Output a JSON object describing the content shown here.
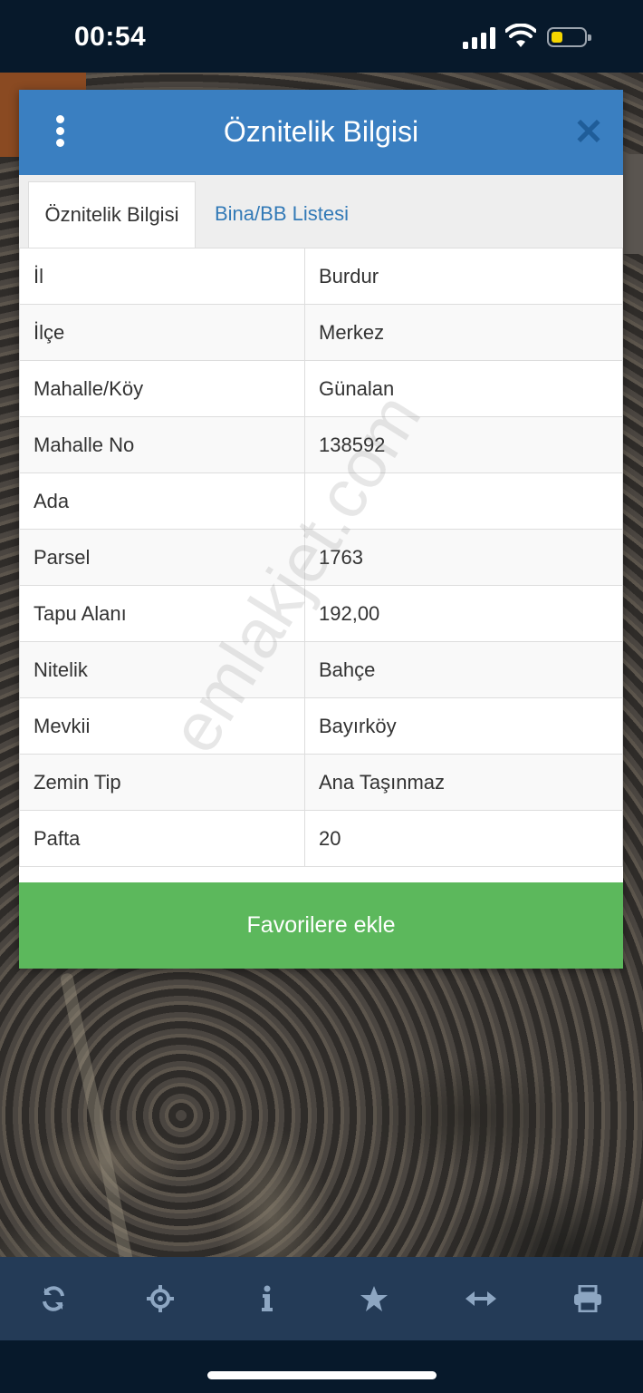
{
  "status_bar": {
    "time": "00:54",
    "icons": [
      "cellular-signal-icon",
      "wifi-icon",
      "battery-low-icon"
    ],
    "battery_color": "#f5d600"
  },
  "modal": {
    "title": "Öznitelik Bilgisi",
    "header_color": "#3a7fc1",
    "tabs": [
      {
        "label": "Öznitelik Bilgisi",
        "active": true
      },
      {
        "label": "Bina/BB Listesi",
        "active": false
      }
    ],
    "rows": [
      {
        "key": "İl",
        "value": "Burdur"
      },
      {
        "key": "İlçe",
        "value": "Merkez"
      },
      {
        "key": "Mahalle/Köy",
        "value": "Günalan"
      },
      {
        "key": "Mahalle No",
        "value": "138592"
      },
      {
        "key": "Ada",
        "value": ""
      },
      {
        "key": "Parsel",
        "value": "1763"
      },
      {
        "key": "Tapu Alanı",
        "value": "192,00"
      },
      {
        "key": "Nitelik",
        "value": "Bahçe"
      },
      {
        "key": "Mevkii",
        "value": "Bayırköy"
      },
      {
        "key": "Zemin Tip",
        "value": "Ana Taşınmaz"
      },
      {
        "key": "Pafta",
        "value": "20"
      }
    ],
    "favorite_button_label": "Favorilere ekle",
    "favorite_button_color": "#5cb85c"
  },
  "watermark": "emlakjet.com",
  "toolbar": {
    "buttons": [
      "refresh-icon",
      "locate-crosshair-icon",
      "info-icon",
      "star-icon",
      "measure-arrows-icon",
      "print-icon"
    ]
  }
}
